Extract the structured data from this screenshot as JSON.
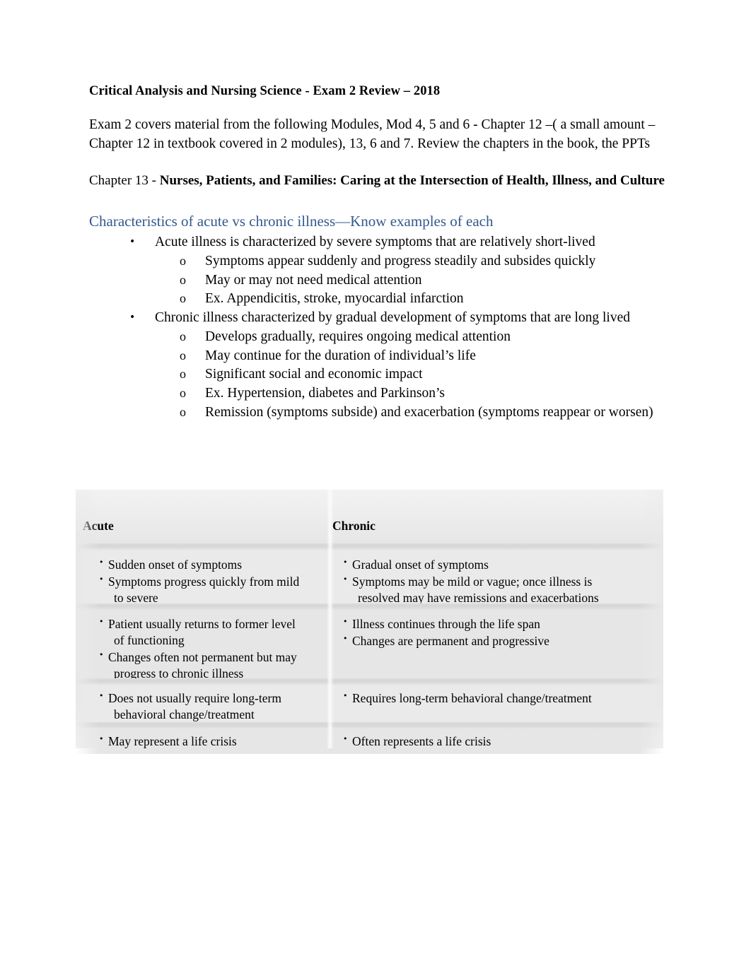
{
  "document": {
    "title": "Critical Analysis and Nursing Science - Exam 2 Review – 2018",
    "intro_paragraph": "Exam 2 covers material from the following Modules, Mod 4, 5 and 6  - Chapter 12 –( a small amount – Chapter 12 in textbook covered in 2 modules), 13, 6 and 7. Review the chapters in the book, the PPTs",
    "chapter": {
      "label": "Chapter 13 - ",
      "title": "Nurses, Patients, and Families: Caring at the Intersection of Health, Illness, and Culture"
    },
    "section_heading": "Characteristics of acute vs chronic illness—Know examples of each",
    "heading_color": "#33598C",
    "bullet_level1_glyph": "•",
    "bullet_level2_glyph": "o",
    "outline": [
      {
        "text": "Acute illness is characterized by severe symptoms that are relatively short-lived",
        "children": [
          "Symptoms appear suddenly and progress steadily and subsides quickly",
          "May or may not need medical attention",
          "Ex. Appendicitis, stroke, myocardial infarction"
        ]
      },
      {
        "text": "Chronic illness characterized by gradual development of symptoms that are long lived",
        "children": [
          "Develops gradually, requires ongoing medical attention",
          "May continue for the duration of individual’s life",
          "Significant social and economic impact",
          "Ex. Hypertension, diabetes and Parkinson’s",
          "Remission (symptoms subside) and exacerbation (symptoms reappear or worsen)"
        ]
      }
    ],
    "comparison_table": {
      "headers": [
        "Acute",
        "Chronic"
      ],
      "bullet_glyph": "•",
      "rows": [
        {
          "acute": [
            {
              "line1": "Sudden onset of symptoms",
              "line2": ""
            },
            {
              "line1": "Symptoms progress quickly from mild",
              "line2": "to severe"
            }
          ],
          "chronic": [
            {
              "line1": "Gradual onset of symptoms",
              "line2": ""
            },
            {
              "line1": "Symptoms may be mild or vague; once illness is",
              "line2": "resolved may have remissions and exacerbations"
            }
          ]
        },
        {
          "acute": [
            {
              "line1": "Patient usually returns to former level",
              "line2": "of functioning"
            },
            {
              "line1": "Changes often not permanent but may",
              "line2": "progress to chronic illness"
            }
          ],
          "chronic": [
            {
              "line1": "Illness continues through the life span",
              "line2": ""
            },
            {
              "line1": "Changes are permanent and progressive",
              "line2": ""
            }
          ]
        },
        {
          "acute": [
            {
              "line1": "Does not usually require long-term",
              "line2": "behavioral change/treatment"
            }
          ],
          "chronic": [
            {
              "line1": "Requires long-term behavioral change/treatment",
              "line2": ""
            }
          ]
        },
        {
          "acute": [
            {
              "line1": "May represent a life crisis",
              "line2": ""
            }
          ],
          "chronic": [
            {
              "line1": "Often represents a life crisis",
              "line2": ""
            }
          ]
        }
      ]
    }
  }
}
